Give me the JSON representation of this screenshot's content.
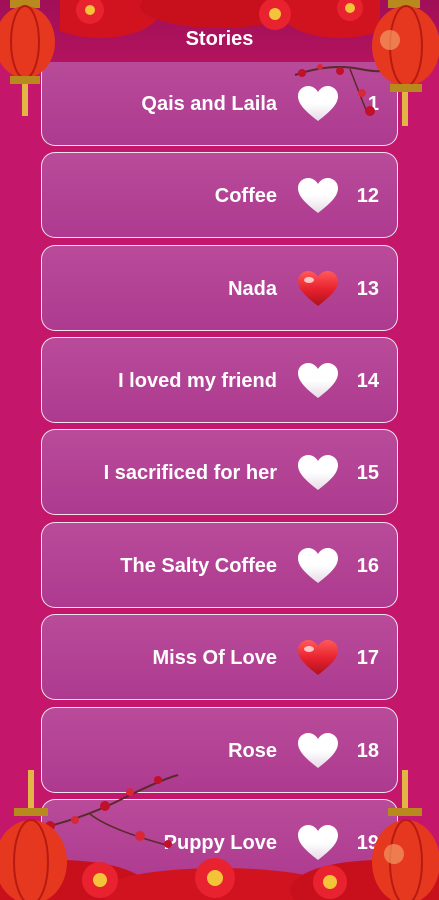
{
  "header": {
    "title": "Stories"
  },
  "stories": [
    {
      "title": "Qais and Laila",
      "number": "1",
      "favorite": false
    },
    {
      "title": "Coffee",
      "number": "12",
      "favorite": false
    },
    {
      "title": "Nada",
      "number": "13",
      "favorite": true
    },
    {
      "title": "I loved my friend",
      "number": "14",
      "favorite": false
    },
    {
      "title": "I sacrificed for her",
      "number": "15",
      "favorite": false
    },
    {
      "title": "The Salty Coffee",
      "number": "16",
      "favorite": false
    },
    {
      "title": "Miss Of Love",
      "number": "17",
      "favorite": true
    },
    {
      "title": "Rose",
      "number": "18",
      "favorite": false
    },
    {
      "title": "Puppy Love",
      "number": "19",
      "favorite": false
    }
  ],
  "colors": {
    "background": "#c4166b",
    "card": "#b3429a",
    "heart_favorite": "#e8232f",
    "heart_default": "#ffffff"
  },
  "icons": {
    "favorite": "heart-icon-filled-red",
    "not_favorite": "heart-icon-white"
  }
}
